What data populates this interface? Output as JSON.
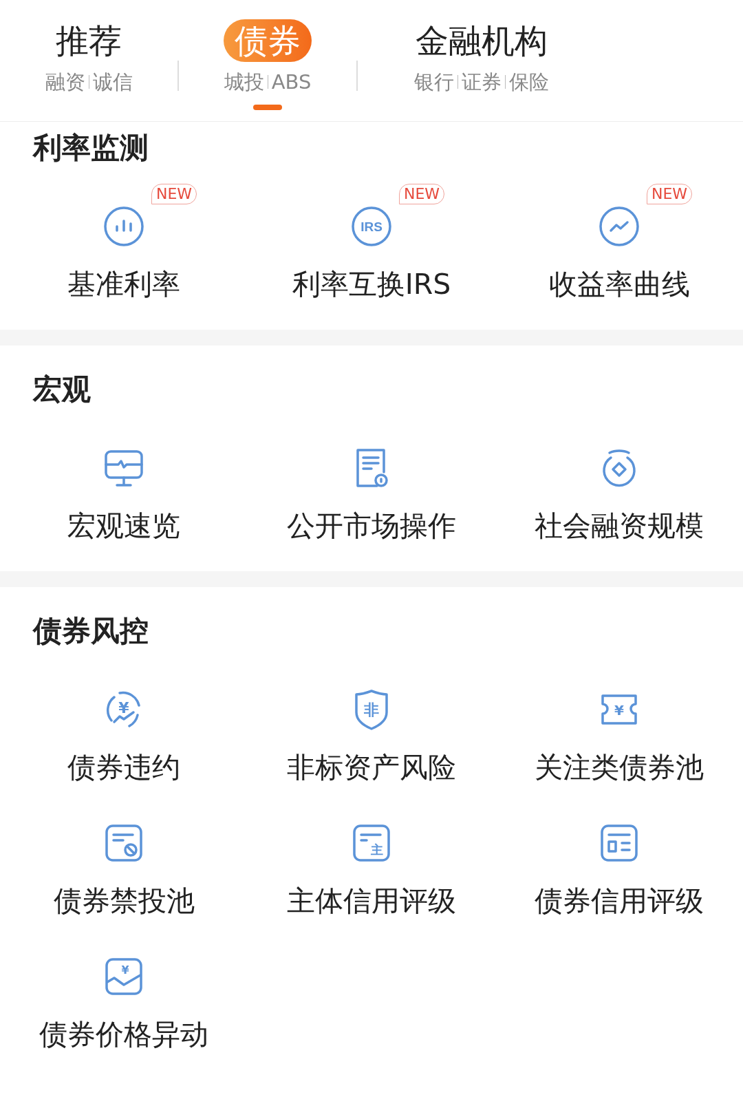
{
  "tabs": [
    {
      "title": "推荐",
      "subtitles": [
        "融资",
        "诚信"
      ],
      "selected": false
    },
    {
      "title": "债券",
      "subtitles": [
        "城投",
        "ABS"
      ],
      "selected": true
    },
    {
      "title": "金融机构",
      "subtitles": [
        "银行",
        "证券",
        "保险"
      ],
      "selected": false
    }
  ],
  "sections": [
    {
      "title": "利率监测",
      "items": [
        {
          "label": "基准利率",
          "kind": "bars-circle",
          "badge": "NEW"
        },
        {
          "label": "利率互换IRS",
          "kind": "text-circle",
          "icon_text": "IRS",
          "badge": "NEW"
        },
        {
          "label": "收益率曲线",
          "kind": "trend-circle",
          "badge": "NEW"
        }
      ]
    },
    {
      "title": "宏观",
      "items": [
        {
          "label": "宏观速览",
          "kind": "monitor"
        },
        {
          "label": "公开市场操作",
          "kind": "document"
        },
        {
          "label": "社会融资规模",
          "kind": "coin"
        }
      ]
    },
    {
      "title": "债券风控",
      "items": [
        {
          "label": "债券违约",
          "kind": "yen-cycle",
          "icon_text": "¥"
        },
        {
          "label": "非标资产风险",
          "kind": "shield",
          "icon_text": "非"
        },
        {
          "label": "关注类债券池",
          "kind": "ticket",
          "icon_text": "¥"
        },
        {
          "label": "债券禁投池",
          "kind": "ban-card"
        },
        {
          "label": "主体信用评级",
          "kind": "text-card",
          "icon_text": "主"
        },
        {
          "label": "债券信用评级",
          "kind": "layout-card"
        },
        {
          "label": "债券价格异动",
          "kind": "wave-card",
          "icon_text": "¥"
        }
      ]
    }
  ]
}
